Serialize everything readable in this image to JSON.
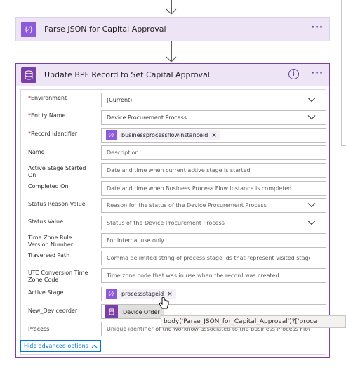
{
  "step1": {
    "title": "Parse JSON for Capital Approval",
    "icon": "data-operation-icon",
    "more": "···"
  },
  "step2": {
    "title": "Update BPF Record to Set Capital Approval",
    "icon": "database-icon",
    "info_glyph": "i",
    "more": "···",
    "fields": [
      {
        "label": "Environment",
        "required": true,
        "value": "(Current)",
        "placeholder": "",
        "dropdown": true
      },
      {
        "label": "Entity Name",
        "required": true,
        "value": "Device Procurement Process",
        "placeholder": "",
        "dropdown": true
      },
      {
        "label": "Record identifier",
        "required": true,
        "chip": "businessprocessflowinstanceid"
      },
      {
        "label": "Name",
        "required": false,
        "placeholder": "Description"
      },
      {
        "label": "Active Stage Started On",
        "required": false,
        "placeholder": "Date and time when current active stage is started"
      },
      {
        "label": "Completed On",
        "required": false,
        "placeholder": "Date and time when Business Process Flow instance is completed."
      },
      {
        "label": "Status Reason Value",
        "required": false,
        "placeholder": "Reason for the status of the Device Procurement Process",
        "dropdown": true
      },
      {
        "label": "Status Value",
        "required": false,
        "placeholder": "Status of the Device Procurement Process",
        "dropdown": true
      },
      {
        "label": "Time Zone Rule Version Number",
        "required": false,
        "placeholder": "For internal use only."
      },
      {
        "label": "Traversed Path",
        "required": false,
        "placeholder": "Comma delimited string of process stage ids that represent visited stages of"
      },
      {
        "label": "UTC Conversion Time Zone Code",
        "required": false,
        "placeholder": "Time zone code that was in use when the record was created."
      },
      {
        "label": "Active Stage",
        "required": false,
        "chip": "processstageid"
      },
      {
        "label": "New_Deviceorder",
        "required": false,
        "chip_entity": "Device Order"
      },
      {
        "label": "Process",
        "required": false,
        "placeholder": "Unique identifier of the workflow associated to the business Process Flow"
      }
    ],
    "hide_advanced": "Hide advanced options"
  },
  "tooltip": "body('Parse_JSON_for_Capital_Approval')?['proce",
  "required_mark": "*",
  "colors": {
    "accent": "#8f5ad9",
    "dataverse": "#7b3fa8",
    "header_bg": "#ede4f6",
    "link": "#0078d4",
    "required": "#a4262c"
  }
}
